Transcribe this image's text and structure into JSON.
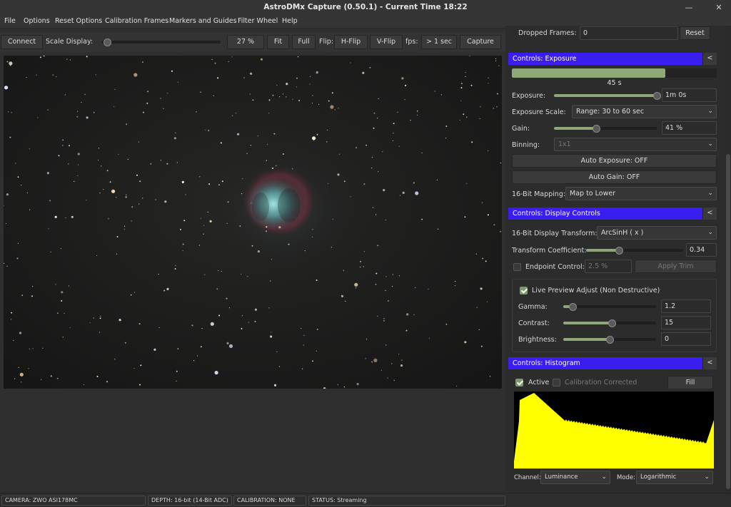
{
  "window": {
    "title": "AstroDMx Capture (0.50.1) - Current Time 18:22",
    "minimize": "—",
    "close": "✕"
  },
  "menu": [
    "File",
    "Options",
    "Reset Options",
    "Calibration Frames",
    "Markers and Guides",
    "Filter Wheel",
    "Help"
  ],
  "toolbar": {
    "connect": "Connect",
    "scale_display_label": "Scale Display:",
    "scale_value": "27 %",
    "fit": "Fit",
    "full": "Full",
    "flip_label": "Flip:",
    "hflip": "H-Flip",
    "vflip": "V-Flip",
    "fps_label": "fps:",
    "fps_value": "> 1 sec",
    "capture": "Capture",
    "scale_level": 0.04
  },
  "top_controls": {
    "dropped_frames_label": "Dropped Frames:",
    "dropped_frames_value": "0",
    "reset": "Reset"
  },
  "exposure": {
    "header": "Controls: Exposure",
    "collapse": "<",
    "progress_fraction": 0.75,
    "progress_text": "45 s",
    "exposure_label": "Exposure:",
    "exposure_level": 1.0,
    "exposure_value": "1m 0s",
    "scale_label": "Exposure Scale:",
    "scale_value": "Range: 30 to 60 sec",
    "gain_label": "Gain:",
    "gain_level": 0.41,
    "gain_value": "41 %",
    "binning_label": "Binning:",
    "binning_value": "1x1",
    "auto_exposure": "Auto Exposure: OFF",
    "auto_gain": "Auto Gain: OFF",
    "mapping_label": "16-Bit Mapping:",
    "mapping_value": "Map to Lower"
  },
  "display": {
    "header": "Controls: Display Controls",
    "collapse": "<",
    "transform_label": "16-Bit Display Transform:",
    "transform_value": "ArcSinH ( x )",
    "coef_label": "Transform Coefficient:",
    "coef_level": 0.34,
    "coef_value": "0.34",
    "endpoint_label": "Endpoint Control:",
    "endpoint_value": "2.5 %",
    "apply_trim": "Apply Trim",
    "live_preview_label": "Live Preview Adjust (Non Destructive)",
    "gamma_label": "Gamma:",
    "gamma_level": 0.1,
    "gamma_value": "1.2",
    "contrast_label": "Contrast:",
    "contrast_level": 0.52,
    "contrast_value": "15",
    "brightness_label": "Brightness:",
    "brightness_level": 0.5,
    "brightness_value": "0"
  },
  "histogram": {
    "header": "Controls: Histogram",
    "collapse": "<",
    "active_label": "Active",
    "calib_label": "Calibration Corrected",
    "fill": "Fill",
    "channel_label": "Channel:",
    "channel_value": "Luminance",
    "mode_label": "Mode:",
    "mode_value": "Logarithmic"
  },
  "status": {
    "camera": "CAMERA: ZWO ASI178MC",
    "depth": "DEPTH: 16-bit (14-Bit ADC)",
    "calibration": "CALIBRATION: NONE",
    "state": "STATUS: Streaming"
  },
  "colors": {
    "accent_header": "#3a1ef0",
    "slider_fill": "#8fa878",
    "histogram_fill": "#ffff00"
  }
}
